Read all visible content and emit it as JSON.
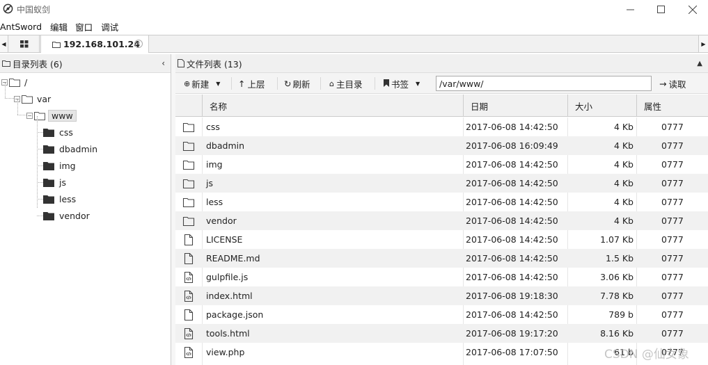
{
  "window": {
    "title": "中国蚁剑",
    "icon": "antsword-icon"
  },
  "menu": [
    "AntSword",
    "编辑",
    "窗口",
    "调试"
  ],
  "tabs": {
    "active_label": "192.168.101.24"
  },
  "left_panel": {
    "header": "目录列表 (6)",
    "tree": [
      {
        "label": "/",
        "level": 0,
        "expanded": true
      },
      {
        "label": "var",
        "level": 1,
        "expanded": true
      },
      {
        "label": "www",
        "level": 2,
        "expanded": true,
        "selected": true
      },
      {
        "label": "css",
        "level": 3
      },
      {
        "label": "dbadmin",
        "level": 3
      },
      {
        "label": "img",
        "level": 3
      },
      {
        "label": "js",
        "level": 3
      },
      {
        "label": "less",
        "level": 3
      },
      {
        "label": "vendor",
        "level": 3
      }
    ]
  },
  "right_panel": {
    "header": "文件列表 (13)",
    "toolbar": {
      "new_label": "新建",
      "up_label": "上层",
      "refresh_label": "刷新",
      "home_label": "主目录",
      "bookmark_label": "书签",
      "path_value": "/var/www/",
      "read_label": "读取"
    },
    "columns": [
      "名称",
      "日期",
      "大小",
      "属性"
    ],
    "rows": [
      {
        "type": "folder",
        "name": "css",
        "date": "2017-06-08 14:42:50",
        "size": "4 Kb",
        "perm": "0777"
      },
      {
        "type": "folder",
        "name": "dbadmin",
        "date": "2017-06-08 16:09:49",
        "size": "4 Kb",
        "perm": "0777"
      },
      {
        "type": "folder",
        "name": "img",
        "date": "2017-06-08 14:42:50",
        "size": "4 Kb",
        "perm": "0777"
      },
      {
        "type": "folder",
        "name": "js",
        "date": "2017-06-08 14:42:50",
        "size": "4 Kb",
        "perm": "0777"
      },
      {
        "type": "folder",
        "name": "less",
        "date": "2017-06-08 14:42:50",
        "size": "4 Kb",
        "perm": "0777"
      },
      {
        "type": "folder",
        "name": "vendor",
        "date": "2017-06-08 14:42:50",
        "size": "4 Kb",
        "perm": "0777"
      },
      {
        "type": "file",
        "name": "LICENSE",
        "date": "2017-06-08 14:42:50",
        "size": "1.07 Kb",
        "perm": "0777"
      },
      {
        "type": "file",
        "name": "README.md",
        "date": "2017-06-08 14:42:50",
        "size": "1.5 Kb",
        "perm": "0777"
      },
      {
        "type": "code",
        "name": "gulpfile.js",
        "date": "2017-06-08 14:42:50",
        "size": "3.06 Kb",
        "perm": "0777"
      },
      {
        "type": "code",
        "name": "index.html",
        "date": "2017-06-08 19:18:30",
        "size": "7.78 Kb",
        "perm": "0777"
      },
      {
        "type": "file",
        "name": "package.json",
        "date": "2017-06-08 14:42:50",
        "size": "789 b",
        "perm": "0777"
      },
      {
        "type": "code",
        "name": "tools.html",
        "date": "2017-06-08 19:17:20",
        "size": "8.16 Kb",
        "perm": "0777"
      },
      {
        "type": "code",
        "name": "view.php",
        "date": "2017-06-08 17:07:50",
        "size": "61 b",
        "perm": "0777"
      }
    ]
  },
  "watermark": "CSDN @仙女象"
}
